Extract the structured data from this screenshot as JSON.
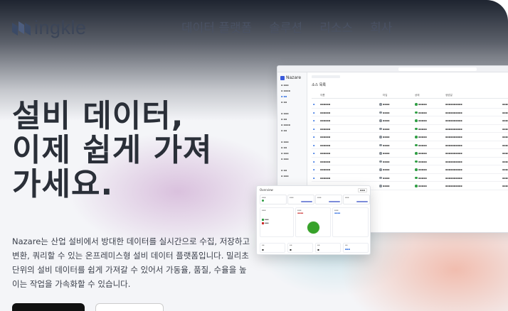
{
  "nav": {
    "logo_text": "ingkle",
    "menu": [
      "데이터 플랫폼",
      "솔루션",
      "리소스",
      "회사"
    ]
  },
  "hero": {
    "title_lines": [
      "설비 데이터,",
      "이제 쉽게 가져",
      "가세요."
    ],
    "description": "Nazare는 산업 설비에서 방대한 데이터를 실시간으로 수집, 저장하고 변환, 쿼리할 수 있는 온프레미스형 설비 데이터 플랫폼입니다. 밀리초 단위의 설비 데이터를 쉽게 가져갈 수 있어서 가동율, 품질, 수율을 높이는 작업을 가속화할 수 있습니다."
  },
  "colors": {
    "accent_blue": "#2b6be0",
    "brand_dark": "#111111",
    "status_green": "#2f9e44"
  },
  "app_window": {
    "brand": "Nazare",
    "page_heading": "소스 목록",
    "columns": [
      "이름",
      "타입",
      "상태",
      "생성일"
    ]
  },
  "dashboard": {
    "title": "Overview"
  }
}
